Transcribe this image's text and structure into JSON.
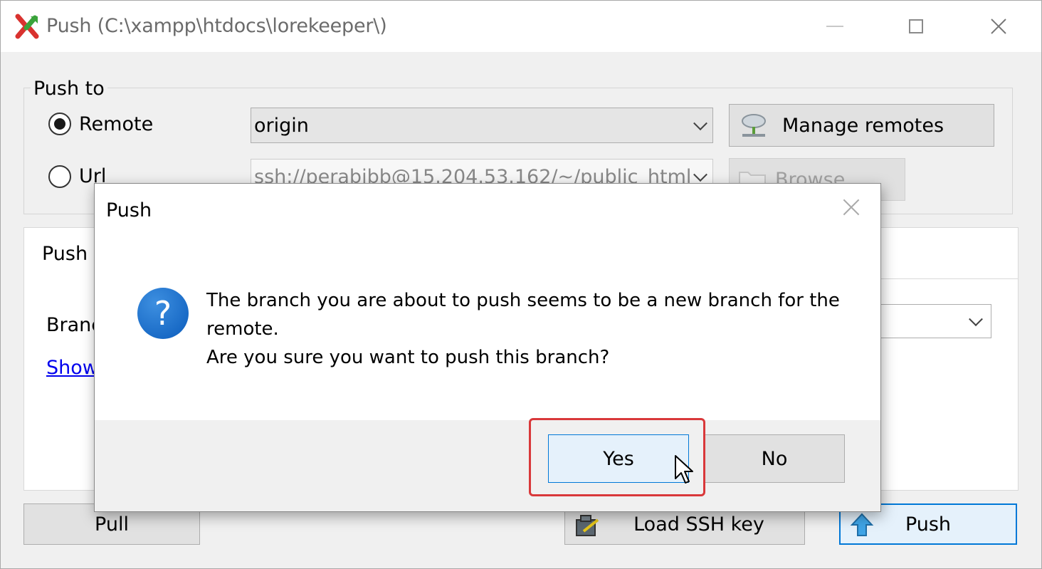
{
  "window": {
    "title": "Push (C:\\xampp\\htdocs\\lorekeeper\\)"
  },
  "push_to": {
    "legend": "Push to",
    "remote_label": "Remote",
    "url_label": "Url",
    "remote_value": "origin",
    "url_value": "ssh://perabibb@15.204.53.162/~/public_html",
    "manage_remotes_label": "Manage remotes",
    "browse_label": "Browse"
  },
  "panel": {
    "title_fragment": "Push",
    "branch_fragment": "Branc",
    "show_link_fragment": "Show"
  },
  "bottom": {
    "pull_label": "Pull",
    "load_ssh_label": "Load SSH key",
    "push_label": "Push"
  },
  "dialog": {
    "title": "Push",
    "message_line1": "The branch you are about to push seems to be a new branch for the",
    "message_line2": "remote.",
    "message_line3": "Are you sure you want to push this branch?",
    "yes_label": "Yes",
    "no_label": "No"
  },
  "colors": {
    "accent": "#0078d7",
    "highlight": "#d9383a",
    "question_icon": "#0b5cbc"
  },
  "icons": {
    "app": "git-extensions-icon",
    "remotes": "network-icon",
    "browse": "folder-icon",
    "ssh": "key-icon",
    "push": "arrow-up-icon",
    "question": "question-icon",
    "cursor": "mouse-pointer-icon"
  }
}
